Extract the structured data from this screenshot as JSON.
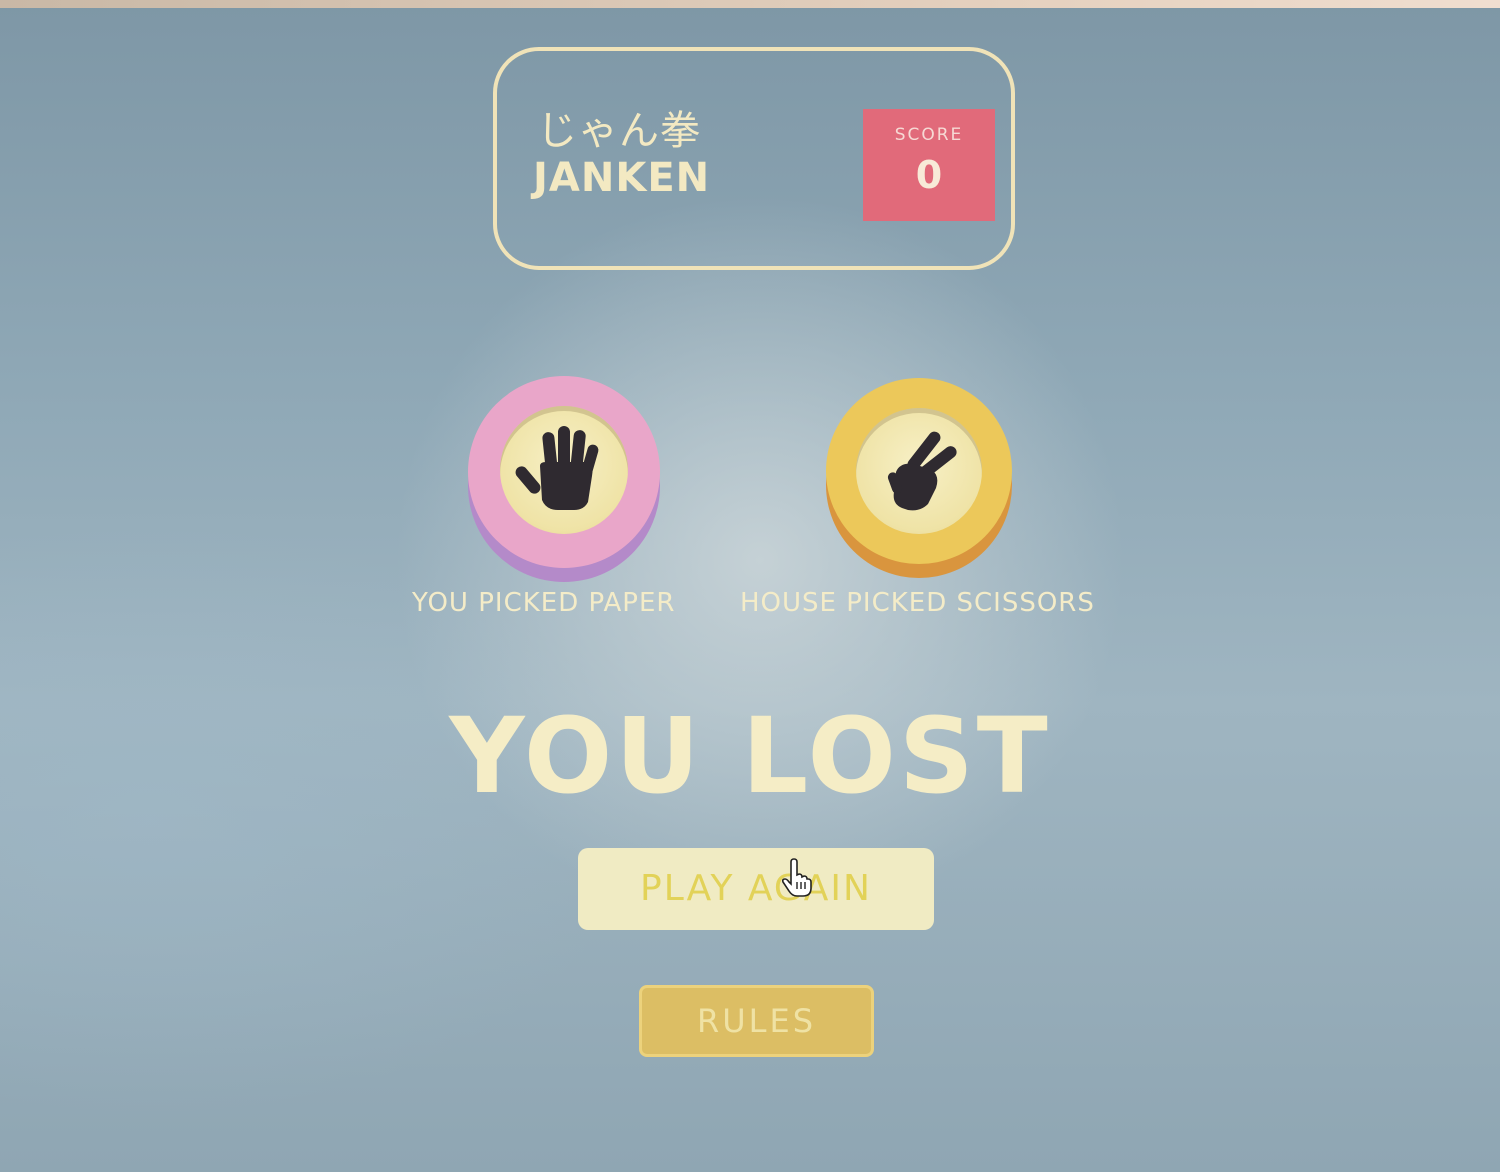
{
  "header": {
    "title_jp": "じゃん拳",
    "title_en": "JANKEN",
    "score_label": "SCORE",
    "score_value": "0"
  },
  "picks": {
    "player": {
      "choice": "paper",
      "icon": "hand-open-icon",
      "label": "YOU PICKED PAPER",
      "ring_color": "#e9a6c9"
    },
    "house": {
      "choice": "scissors",
      "icon": "hand-scissors-icon",
      "label": "HOUSE PICKED SCISSORS",
      "ring_color": "#ecc85a"
    }
  },
  "result": {
    "text": "YOU LOST"
  },
  "buttons": {
    "play_again": "PLAY AGAIN",
    "rules": "RULES"
  },
  "colors": {
    "background": "#90a9b7",
    "text": "#f4ecc8",
    "score_bg": "#e16a7a",
    "rules_bg": "#dcbe64"
  }
}
